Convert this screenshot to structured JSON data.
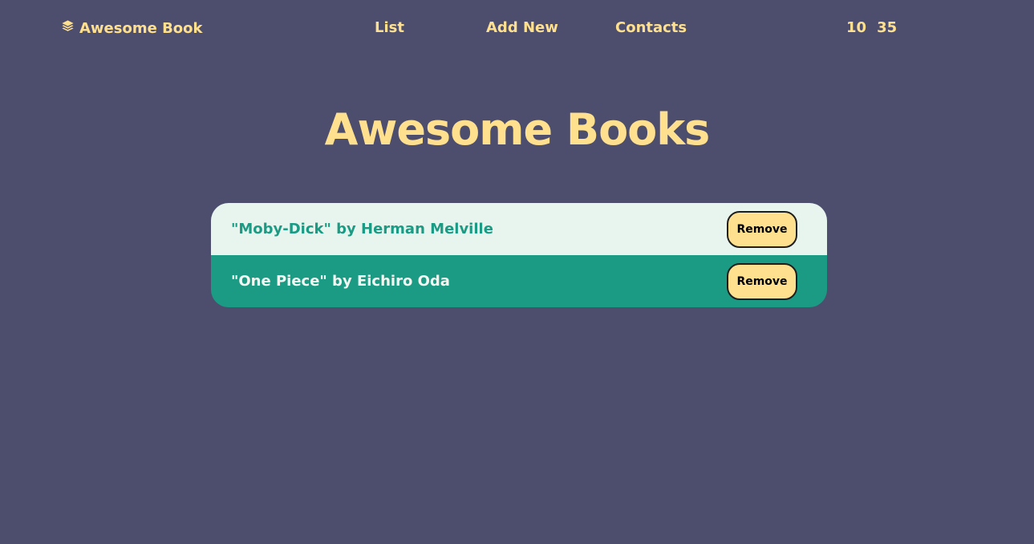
{
  "nav": {
    "brand": "Awesome Book",
    "links": [
      "List",
      "Add New",
      "Contacts"
    ],
    "time": {
      "hours": "10",
      "minutes": "35"
    }
  },
  "main": {
    "title": "Awesome Books",
    "books": [
      {
        "text": "\"Moby-Dick\" by Herman Melville",
        "remove_label": "Remove"
      },
      {
        "text": "\"One Piece\" by Eichiro Oda",
        "remove_label": "Remove"
      }
    ]
  },
  "colors": {
    "background": "#4d4d6d",
    "accent": "#ffe08f",
    "row_light": "#e8f5ef",
    "row_dark": "#1c9b84"
  }
}
